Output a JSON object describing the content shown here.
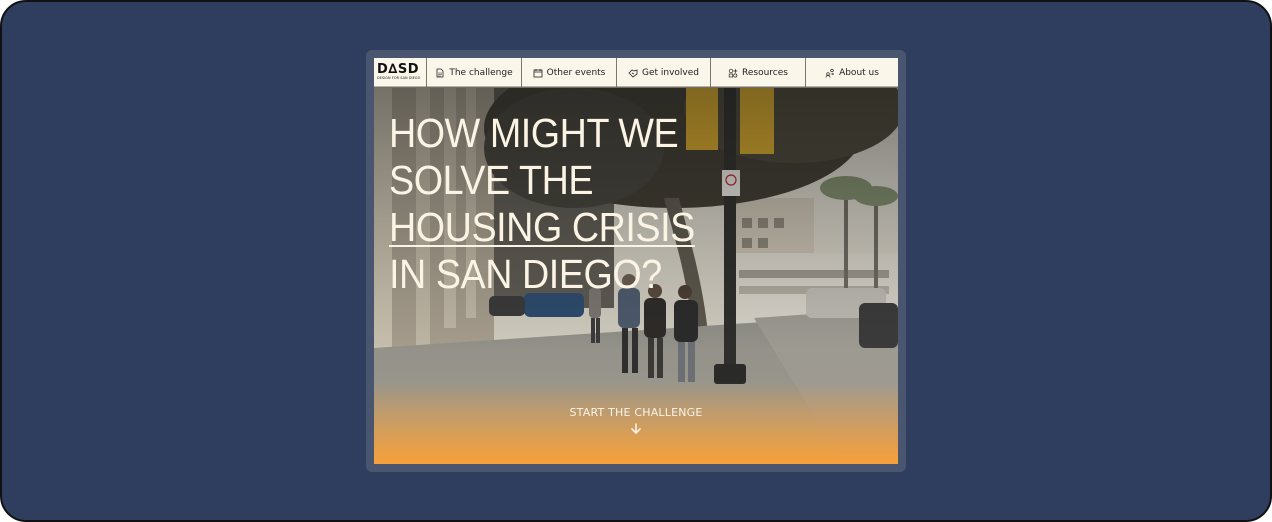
{
  "logo": {
    "mark": "D∆SD",
    "tagline": "DESIGN FOR SAN DIEGO"
  },
  "nav": {
    "items": [
      {
        "label": "The challenge",
        "icon": "document-icon"
      },
      {
        "label": "Other events",
        "icon": "calendar-icon"
      },
      {
        "label": "Get involved",
        "icon": "handshake-icon"
      },
      {
        "label": "Resources",
        "icon": "shapes-icon"
      },
      {
        "label": "About us",
        "icon": "people-swap-icon"
      }
    ]
  },
  "hero": {
    "headline": {
      "line1": "HOW MIGHT WE",
      "line2": "SOLVE THE",
      "line3": "HOUSING CRISIS",
      "line4": "IN SAN DIEGO?"
    },
    "cta_label": "START THE CHALLENGE",
    "cta_icon": "arrow-down-icon"
  },
  "colors": {
    "desktop_background": "#2f3d5f",
    "nav_background": "#fbf6ea",
    "headline_text": "#fbf3e4",
    "accent_orange": "#f5a03a",
    "banner_yellow": "#e0b12a"
  }
}
